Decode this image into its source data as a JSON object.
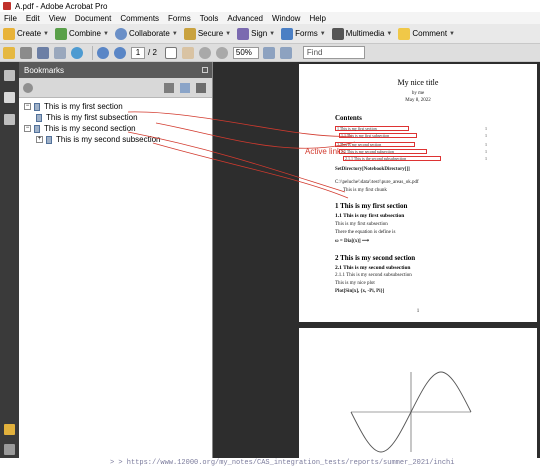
{
  "window": {
    "title": "A.pdf - Adobe Acrobat Pro"
  },
  "menubar": {
    "items": [
      "File",
      "Edit",
      "View",
      "Document",
      "Comments",
      "Forms",
      "Tools",
      "Advanced",
      "Window",
      "Help"
    ]
  },
  "toolbar1": {
    "create": "Create",
    "combine": "Combine",
    "collaborate": "Collaborate",
    "secure": "Secure",
    "sign": "Sign",
    "forms": "Forms",
    "multimedia": "Multimedia",
    "comment": "Comment"
  },
  "toolbar2": {
    "current_page": "1",
    "page_total": "/ 2",
    "zoom": "50%",
    "find_placeholder": "Find"
  },
  "bookmarks": {
    "header": "Bookmarks",
    "items": [
      {
        "label": "This is my first section",
        "level": 1,
        "expander": "⊟"
      },
      {
        "label": "This is my first subsection",
        "level": 2
      },
      {
        "label": "This is my second section",
        "level": 1,
        "expander": "⊟"
      },
      {
        "label": "This is my second subsection",
        "level": 2,
        "expander": "⊞"
      }
    ]
  },
  "annotation": {
    "label": "Active links",
    "color": "#d23a2e"
  },
  "page1": {
    "title": "My nice title",
    "author": "by me",
    "date": "May 8, 2022",
    "contents_heading": "Contents",
    "toc": [
      {
        "label": "1  This is my first section",
        "page": "1"
      },
      {
        "label": "1.1  This is my first subsection",
        "page": "1"
      },
      {
        "label": "2  This is my second section",
        "page": "1"
      },
      {
        "label": "2.1  This is my second subsection",
        "page": "1"
      },
      {
        "label": "2.1.1  This is the second subsubsection",
        "page": "1"
      }
    ],
    "set_dir": "SetDirectory[NotebookDirectory[]]",
    "path_line": "C:\\\\peluche\\\\data\\\\test\\\\pure_areas_ok.pdf",
    "this_first": "This is my first chunk",
    "sec1": "1   This is my first section",
    "sub11": "1.1   This is my first subsection",
    "sub11_text": "This is my first subsection",
    "formula_text": "There the equation is define is",
    "formula": "ω = Dia[(x)] ⟶",
    "sec2": "2   This is my second section",
    "sub21": "2.1   This is my second subsection",
    "sub211": "2.1.1   This is my second subsubsection",
    "plot_text": "This is my nice plot",
    "plot_cmd": "Plot[Sin[x], {x, -Pi, Pi}]",
    "page_number": "1"
  },
  "statusbar": {
    "text": "> > https://www.12000.org/my_notes/CAS_integration_tests/reports/summer_2021/inchi"
  }
}
